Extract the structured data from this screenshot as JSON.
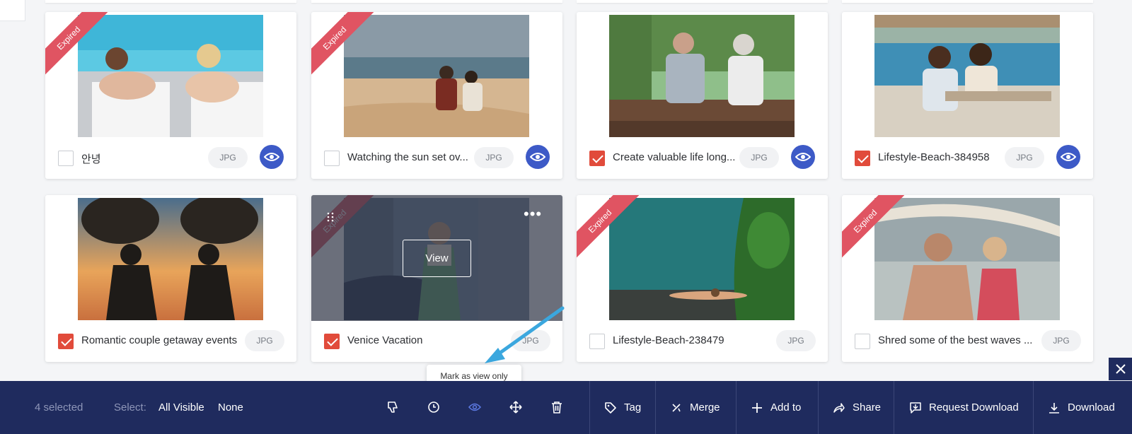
{
  "cards": [
    {
      "name": "안녕",
      "ext": "JPG",
      "checked": false,
      "expired": true,
      "view_only": true
    },
    {
      "name": "Watching the sun set ov...",
      "ext": "JPG",
      "checked": false,
      "expired": true,
      "view_only": true
    },
    {
      "name": "Create valuable life long...",
      "ext": "JPG",
      "checked": true,
      "expired": false,
      "view_only": true
    },
    {
      "name": "Lifestyle-Beach-384958",
      "ext": "JPG",
      "checked": true,
      "expired": false,
      "view_only": true
    },
    {
      "name": "Romantic couple getaway events",
      "ext": "JPG",
      "checked": true,
      "expired": false,
      "view_only": false
    },
    {
      "name": "Venice Vacation",
      "ext": "JPG",
      "checked": true,
      "expired": true,
      "view_only": false,
      "hovered": true
    },
    {
      "name": "Lifestyle-Beach-238479",
      "ext": "JPG",
      "checked": false,
      "expired": true,
      "view_only": false
    },
    {
      "name": "Shred some of the best waves ...",
      "ext": "JPG",
      "checked": false,
      "expired": true,
      "view_only": false
    }
  ],
  "ribbon_label": "Expired",
  "hover": {
    "view_label": "View",
    "more_icon": "ellipsis-icon",
    "drag_icon": "drag-handle-icon"
  },
  "tooltip": "Mark as view only",
  "toolbar": {
    "selected_count": "4 selected",
    "select_label": "Select:",
    "all_visible": "All Visible",
    "none": "None",
    "tools": [
      "thumbs-down-icon",
      "clock-icon",
      "eye-icon",
      "move-icon",
      "trash-icon"
    ],
    "actions": [
      {
        "label": "Tag",
        "icon": "tag-icon"
      },
      {
        "label": "Merge",
        "icon": "merge-icon"
      },
      {
        "label": "Add to",
        "icon": "plus-icon"
      },
      {
        "label": "Share",
        "icon": "share-icon"
      },
      {
        "label": "Request Download",
        "icon": "request-download-icon"
      },
      {
        "label": "Download",
        "icon": "download-icon"
      }
    ]
  },
  "colors": {
    "toolbar_bg": "#1f2b5e",
    "accent_blue": "#3d5ac7",
    "ribbon_red": "#e05462",
    "check_red": "#e14b3b",
    "annotation_arrow": "#3ba7de"
  }
}
